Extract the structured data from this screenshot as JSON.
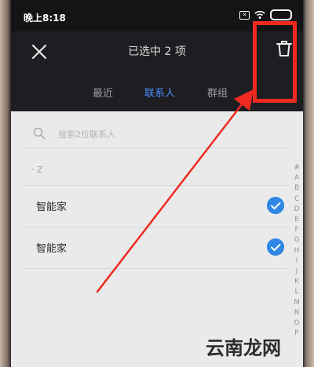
{
  "status_bar": {
    "time": "晚上8:18"
  },
  "header": {
    "title": "已选中 2 项"
  },
  "tabs": [
    {
      "label": "最近",
      "active": false
    },
    {
      "label": "联系人",
      "active": true
    },
    {
      "label": "群组",
      "active": false
    }
  ],
  "search": {
    "placeholder": "搜索2位联系人"
  },
  "section": {
    "letter": "Z"
  },
  "contacts": [
    {
      "name": "智能家",
      "checked": true
    },
    {
      "name": "智能家",
      "checked": true
    }
  ],
  "index_letters": [
    "#",
    "A",
    "B",
    "C",
    "D",
    "E",
    "F",
    "G",
    "H",
    "I",
    "J",
    "K",
    "L",
    "M",
    "N",
    "O",
    "P"
  ],
  "colors": {
    "accent": "#4a8cf7",
    "check": "#2f86e5",
    "highlight": "#ef2a21",
    "annotation_arrow": "#ef2a21"
  },
  "watermark": "云南龙网"
}
